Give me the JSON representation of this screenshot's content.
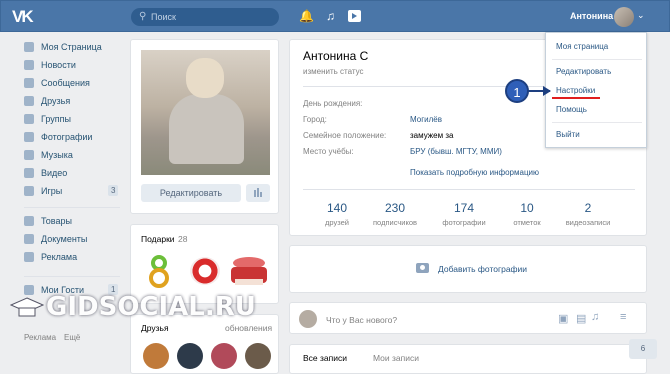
{
  "topbar": {
    "logo": "VK",
    "search_placeholder": "Поиск",
    "user_name": "Антонина"
  },
  "left_menu": [
    {
      "label": "Моя Страница",
      "icon": "home-icon"
    },
    {
      "label": "Новости",
      "icon": "news-icon"
    },
    {
      "label": "Сообщения",
      "icon": "messages-icon"
    },
    {
      "label": "Друзья",
      "icon": "friends-icon"
    },
    {
      "label": "Группы",
      "icon": "groups-icon"
    },
    {
      "label": "Фотографии",
      "icon": "camera-icon"
    },
    {
      "label": "Музыка",
      "icon": "music-icon"
    },
    {
      "label": "Видео",
      "icon": "video-icon"
    },
    {
      "label": "Игры",
      "icon": "games-icon",
      "count": "3"
    },
    {
      "label": "Товары",
      "icon": "bag-icon"
    },
    {
      "label": "Документы",
      "icon": "document-icon"
    },
    {
      "label": "Реклама",
      "icon": "ads-icon"
    },
    {
      "label": "Мои Гости",
      "icon": "guests-icon",
      "count": "1"
    }
  ],
  "left_footer": {
    "ads": "Реклама",
    "more": "Ещё"
  },
  "profile": {
    "edit_button": "Редактировать",
    "gifts_title": "Подарки",
    "gifts_count": "28",
    "friends_title": "Друзья",
    "updates_link": "обновления"
  },
  "info": {
    "name": "Антонина С",
    "status": "изменить статус",
    "rows": [
      {
        "label": "День рождения:",
        "value": ""
      },
      {
        "label": "Город:",
        "value": "Могилёв"
      },
      {
        "label": "Семейное положение:",
        "value": "замужем за"
      },
      {
        "label": "Место учёбы:",
        "value": "БРУ (бывш. МГТУ, ММИ)"
      }
    ],
    "more_link": "Показать подробную информацию"
  },
  "counters": [
    {
      "num": "140",
      "label": "друзей"
    },
    {
      "num": "230",
      "label": "подписчиков"
    },
    {
      "num": "174",
      "label": "фотографии"
    },
    {
      "num": "10",
      "label": "отметок"
    },
    {
      "num": "2",
      "label": "видеозаписи"
    }
  ],
  "add_photos": "Добавить фотографии",
  "post_placeholder": "Что у Вас нового?",
  "wall_tabs": {
    "all": "Все записи",
    "mine": "Мои записи"
  },
  "dropdown": {
    "items": [
      "Моя страница",
      "Редактировать",
      "Настройки",
      "Помощь",
      "Выйти"
    ]
  },
  "annotation_badge": "1",
  "watermark": "GIDSOCIAL.RU",
  "corner_badge": "6"
}
